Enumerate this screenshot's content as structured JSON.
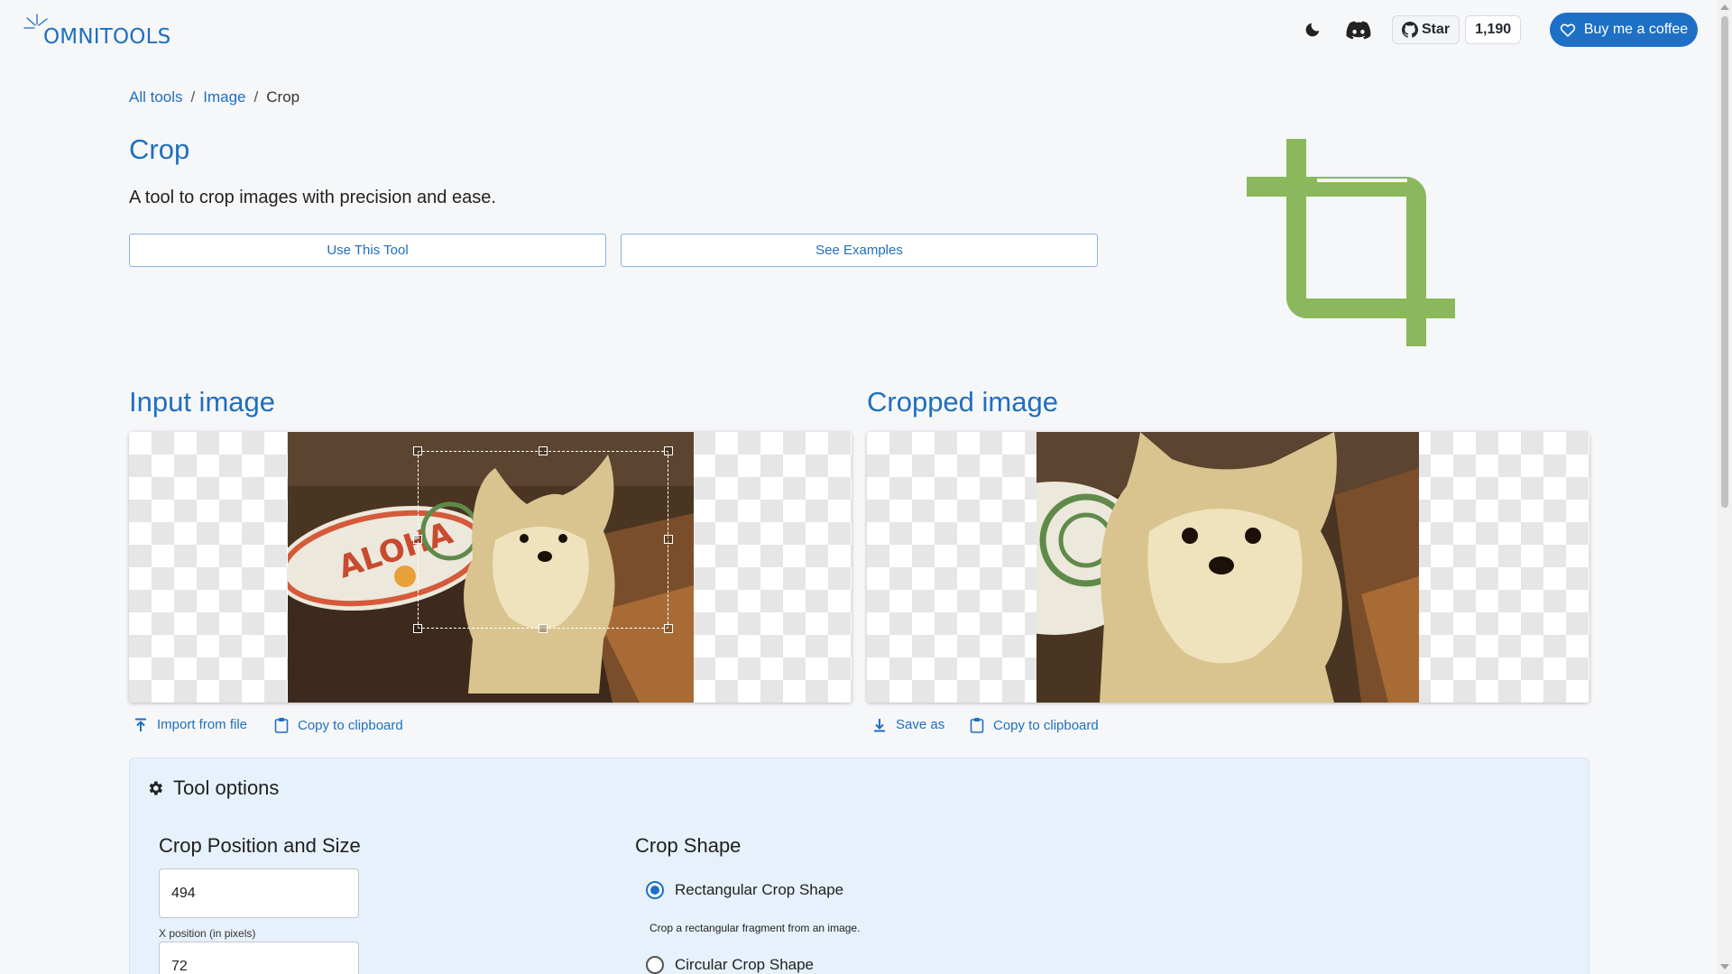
{
  "header": {
    "logo_text": "OMNITOOLS",
    "theme_icon": "moon-icon",
    "discord_icon": "discord-icon",
    "github": {
      "star_label": "Star",
      "star_count": "1,190",
      "icon": "github-icon"
    },
    "coffee_label": "Buy me a coffee",
    "coffee_icon": "heart-icon"
  },
  "breadcrumb": {
    "items": [
      "All tools",
      "Image",
      "Crop"
    ],
    "separator": "/"
  },
  "tool": {
    "title": "Crop",
    "description": "A tool to crop images with precision and ease.",
    "use_button": "Use This Tool",
    "examples_button": "See Examples",
    "hero_icon": "crop-icon",
    "accent_color": "#8bb85c"
  },
  "input": {
    "title": "Input image",
    "import_label": "Import from file",
    "copy_label": "Copy to clipboard"
  },
  "output": {
    "title": "Cropped image",
    "save_label": "Save as",
    "copy_label": "Copy to clipboard"
  },
  "options": {
    "title": "Tool options",
    "position_title": "Crop Position and Size",
    "x_value": "494",
    "x_label": "X position (in pixels)",
    "y_value": "72",
    "shape_title": "Crop Shape",
    "rect_label": "Rectangular Crop Shape",
    "rect_desc": "Crop a rectangular fragment from an image.",
    "circle_label": "Circular Crop Shape",
    "selected_shape": "rectangular"
  },
  "colors": {
    "primary": "#1f6fbf",
    "button": "#1d70c6",
    "options_bg": "#e7f1fb"
  }
}
